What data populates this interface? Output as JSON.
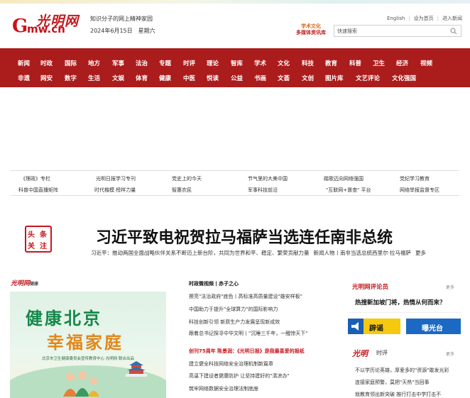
{
  "header": {
    "logo_g": "G",
    "logo_mw": "mw.cn",
    "logo_script": "光明网",
    "slogan": "知识分子的网上精神家园",
    "date": "2024年6月15日",
    "weekday": "星期六",
    "culture_badge": [
      "学术文化",
      "多媒体资讯库"
    ],
    "top_links": [
      "English",
      "设为首页",
      "进入新闻"
    ],
    "search": {
      "placeholder": "快速搜索"
    }
  },
  "nav": {
    "row1": [
      "新闻",
      "时政",
      "国际",
      "地方",
      "军事",
      "法治",
      "专题",
      "时评",
      "理论",
      "智库",
      "学术",
      "文化",
      "科技",
      "教育",
      "科普",
      "卫生",
      "经济",
      "视频"
    ],
    "row2": [
      "非遗",
      "网安",
      "数字",
      "生活",
      "文娱",
      "体育",
      "健康",
      "中医",
      "悦读",
      "公益",
      "书画",
      "文荟",
      "文创",
      "图片库",
      "文艺评论",
      "文化强国"
    ]
  },
  "quick_links": {
    "row1": [
      "《理政》专栏",
      "光明日报学习专刊",
      "党史上的今天",
      "节气里的大美中国",
      "踏歌迈向网络强国",
      "党纪学习教育"
    ],
    "row2": [
      "科普中国直播矩阵",
      "时代楷模 榜样力量",
      "智惠农民",
      "军事科技前沿",
      "\"互联网+督查\" 平台",
      "网络举报监督专区"
    ]
  },
  "headline": {
    "stamp_chars": [
      "头",
      "条",
      "关",
      "注"
    ],
    "title": "习近平致电祝贺拉马福萨当选连任南非总统",
    "sub_items": [
      "习近平：推动两国全面战略伙伴关系不断迈上新台阶，共同为世界和平、稳定、繁荣贡献力量",
      "新闻人物丨南非当选总统西里尔·拉马福萨",
      "更多"
    ]
  },
  "left": {
    "logo": "光明网",
    "logo_sub": "健康",
    "banner": {
      "line1": "健康北京",
      "line2": "幸福家庭",
      "credit": "北京市卫生健康委员会宣传教育中心  光明网 联合出品"
    }
  },
  "middle": {
    "items": [
      {
        "text": "时政微视频丨赤子之心",
        "style": "bold"
      },
      {
        "text": "擦亮\"法治政府\"底色丨高标准高质量建设\"雄安样板\"",
        "style": "normal"
      },
      {
        "text": "中国助力于提升\"全球算力\"的国际影响力",
        "style": "normal"
      },
      {
        "text": "科技创新引领 新质生产力发展呈现新成效",
        "style": "normal"
      },
      {
        "text": "跟着总书记探寻中华文明丨\"沉睡三千年，一醒惊天下\"",
        "style": "normal"
      },
      {
        "text": "创刊75周年 陈景润：《光明日报》是我最喜爱的报纸",
        "style": "red"
      },
      {
        "text": "建立健全科技网络安全治理机制新篇章",
        "style": "normal"
      },
      {
        "text": "高温下建设者健康防护 让坚持建好的\"清凉办\"",
        "style": "normal"
      },
      {
        "text": "筑牢网络数据安全治理法制底座",
        "style": "normal"
      }
    ]
  },
  "right": {
    "forum_logo": "光明网评论员",
    "more": "更多",
    "feature": "热搜新加坡门将，热情从何而来？",
    "rumor_label": "辟谣",
    "expose_label": "曝光台",
    "commentary_logo": "光明",
    "commentary_label": "时评",
    "commentary_more": "更多",
    "commentary_lines": [
      "不以学历论英雄，厚爱多的\"资源\"敢发光彩",
      "连接家庭预警，莫把\"天热\"当回事",
      "就教育领出新突破 推行打击中学打击不"
    ]
  },
  "colors": {
    "brand_red": "#ab1c1c",
    "accent_red": "#c8161d",
    "green": "#13884a",
    "orange": "#e2871a"
  }
}
